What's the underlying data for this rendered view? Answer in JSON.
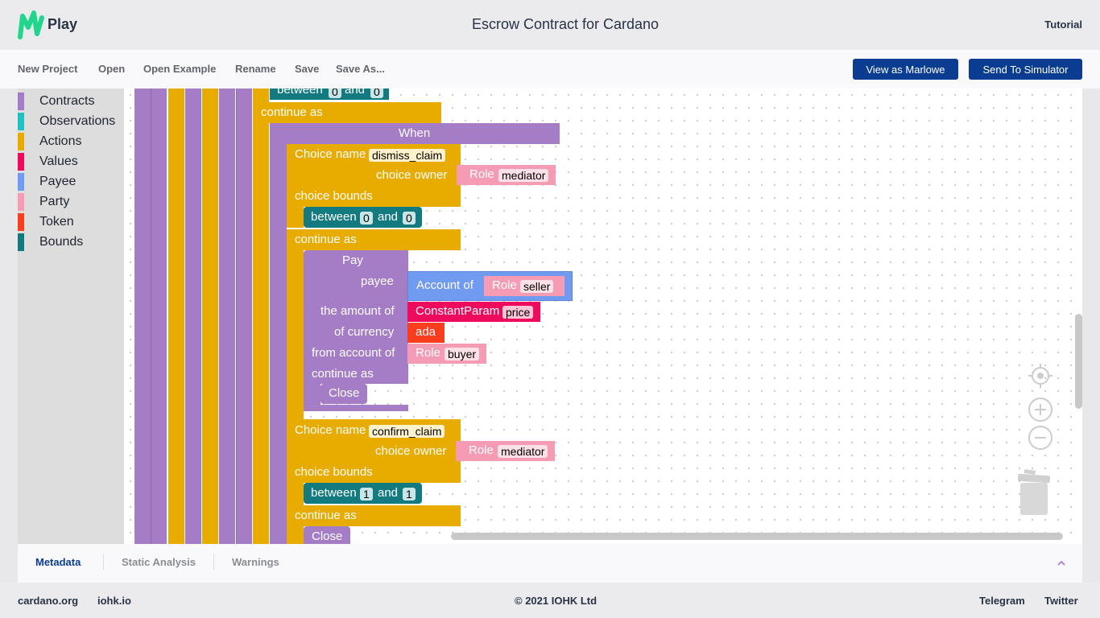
{
  "header": {
    "logo_text": "Play",
    "title": "Escrow Contract for Cardano",
    "tutorial": "Tutorial"
  },
  "menu": {
    "new_project": "New Project",
    "open": "Open",
    "open_example": "Open Example",
    "rename": "Rename",
    "save": "Save",
    "save_as": "Save As...",
    "view_as_marlowe": "View as Marlowe",
    "send_to_simulator": "Send To Simulator"
  },
  "toolbox": {
    "categories": [
      {
        "label": "Contracts",
        "color": "#a57dc6"
      },
      {
        "label": "Observations",
        "color": "#1fc1c3"
      },
      {
        "label": "Actions",
        "color": "#e8ab00"
      },
      {
        "label": "Values",
        "color": "#ee0b5e"
      },
      {
        "label": "Payee",
        "color": "#719af1"
      },
      {
        "label": "Party",
        "color": "#f59bb4"
      },
      {
        "label": "Token",
        "color": "#fa3d1d"
      },
      {
        "label": "Bounds",
        "color": "#137a80"
      }
    ]
  },
  "blocks": {
    "top_between": {
      "label": "between",
      "and": "and",
      "a": "0",
      "b": "0"
    },
    "top_continue_as": "continue as",
    "when": "When",
    "choice1": {
      "choice_name_label": "Choice name",
      "choice_name": "dismiss_claim",
      "choice_owner_label": "choice owner",
      "owner_role_label": "Role",
      "owner_role": "mediator",
      "bounds_label": "choice bounds",
      "between": "between",
      "and": "and",
      "a": "0",
      "b": "0",
      "continue_as": "continue as"
    },
    "pay": {
      "label": "Pay",
      "payee_label": "payee",
      "account_of": "Account of",
      "payee_role_label": "Role",
      "payee_role": "seller",
      "amount_label": "the amount of",
      "constant_param": "ConstantParam",
      "param": "price",
      "currency_label": "of currency",
      "currency": "ada",
      "from_label": "from account of",
      "from_role_label": "Role",
      "from_role": "buyer",
      "continue_as": "continue as",
      "close": "Close"
    },
    "choice2": {
      "choice_name_label": "Choice name",
      "choice_name": "confirm_claim",
      "choice_owner_label": "choice owner",
      "owner_role_label": "Role",
      "owner_role": "mediator",
      "bounds_label": "choice bounds",
      "between": "between",
      "and": "and",
      "a": "1",
      "b": "1",
      "continue_as": "continue as",
      "close": "Close"
    }
  },
  "bottom_tabs": {
    "metadata": "Metadata",
    "static_analysis": "Static Analysis",
    "warnings": "Warnings",
    "collapse_icon": "chevron-up"
  },
  "footer": {
    "cardano": "cardano.org",
    "iohk": "iohk.io",
    "copyright": "© 2021 IOHK Ltd",
    "telegram": "Telegram",
    "twitter": "Twitter"
  }
}
